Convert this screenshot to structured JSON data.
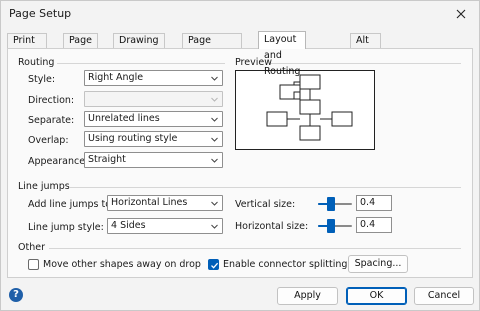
{
  "window": {
    "title": "Page Setup"
  },
  "tabs": [
    "Print Setup",
    "Page Size",
    "Drawing Scale",
    "Page Properties",
    "Layout and Routing",
    "Alt Text"
  ],
  "active_tab": "Layout and Routing",
  "routing": {
    "heading": "Routing",
    "style": {
      "label": "Style:",
      "value": "Right Angle"
    },
    "direction": {
      "label": "Direction:",
      "value": ""
    },
    "separate": {
      "label": "Separate:",
      "value": "Unrelated lines"
    },
    "overlap": {
      "label": "Overlap:",
      "value": "Using routing style"
    },
    "appearance": {
      "label": "Appearance:",
      "value": "Straight"
    }
  },
  "preview": {
    "heading": "Preview"
  },
  "line_jumps": {
    "heading": "Line jumps",
    "add_to": {
      "label": "Add line jumps to:",
      "value": "Horizontal Lines"
    },
    "style": {
      "label": "Line jump style:",
      "value": "4 Sides"
    },
    "vertical_size": {
      "label": "Vertical size:",
      "value": "0.4",
      "slider_fraction": 0.35
    },
    "horizontal_size": {
      "label": "Horizontal size:",
      "value": "0.4",
      "slider_fraction": 0.35
    }
  },
  "other": {
    "heading": "Other",
    "move_shapes": {
      "label": "Move other shapes away on drop",
      "checked": false
    },
    "connector_splitting": {
      "label": "Enable connector splitting",
      "checked": true
    },
    "spacing_button": "Spacing..."
  },
  "buttons": {
    "apply": "Apply",
    "ok": "OK",
    "cancel": "Cancel"
  },
  "help": "?",
  "colors": {
    "accent": "#005fb8",
    "help": "#1f5fa8"
  }
}
